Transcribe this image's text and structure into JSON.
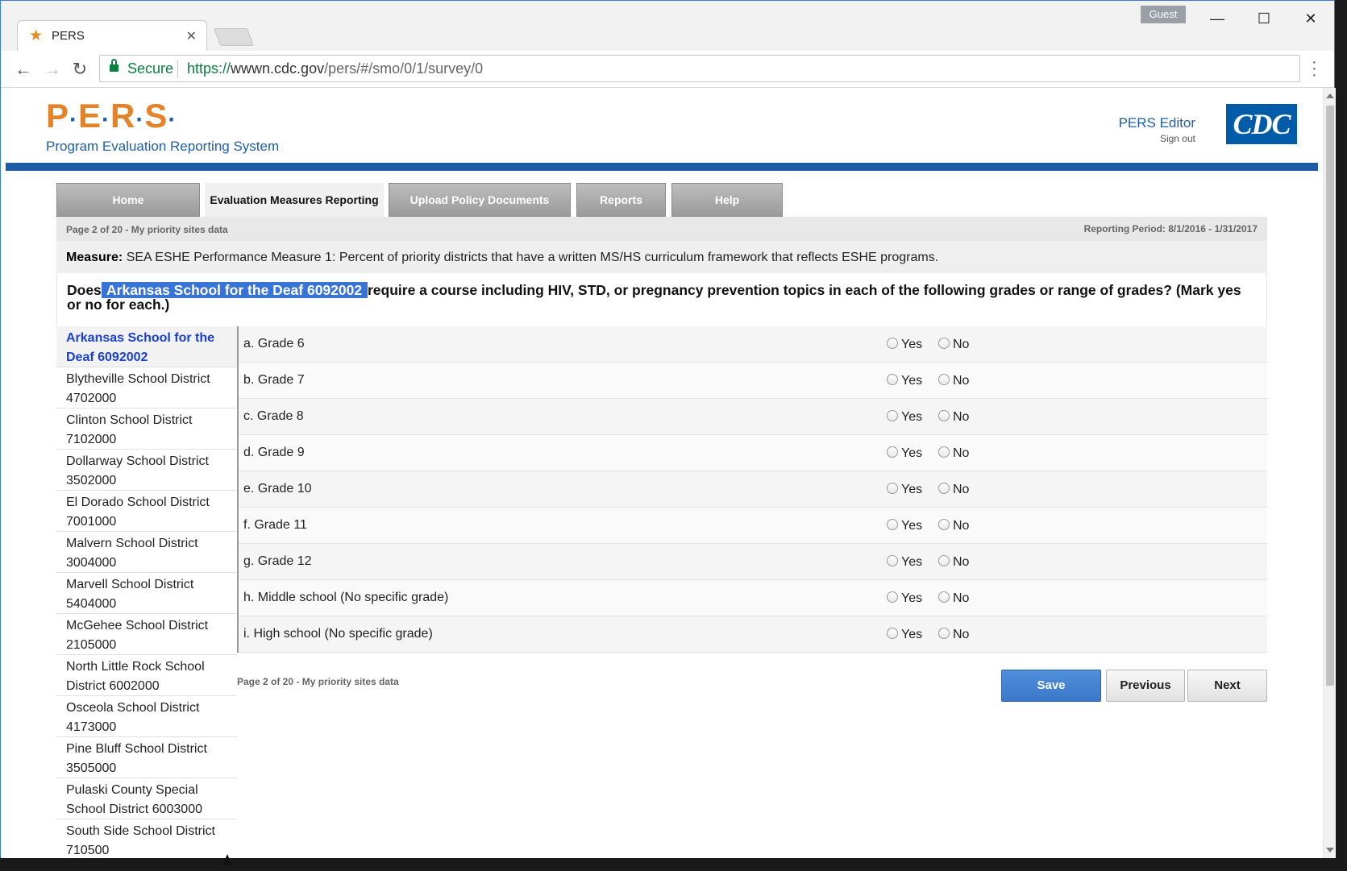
{
  "browser": {
    "tab_title": "PERS",
    "guest_label": "Guest",
    "secure_label": "Secure",
    "url_proto": "https://",
    "url_host": "wwwn.cdc.gov",
    "url_path": "/pers/#/smo/0/1/survey/0"
  },
  "header": {
    "logo_letters": [
      "P",
      "E",
      "R",
      "S"
    ],
    "subtitle": "Program Evaluation Reporting System",
    "user_name": "PERS Editor",
    "sign_out": "Sign out",
    "agency_logo": "CDC"
  },
  "nav": {
    "tabs": [
      {
        "label": "Home",
        "active": false
      },
      {
        "label": "Evaluation Measures Reporting",
        "active": true
      },
      {
        "label": "Upload Policy Documents",
        "active": false
      },
      {
        "label": "Reports",
        "active": false
      },
      {
        "label": "Help",
        "active": false
      }
    ]
  },
  "page": {
    "page_indicator": "Page 2 of 20 - My priority sites data",
    "reporting_period": "Reporting Period: 8/1/2016 - 1/31/2017",
    "measure_label": "Measure:",
    "measure_text": " SEA ESHE Performance Measure 1: Percent of priority districts that have a written MS/HS curriculum framework that reflects ESHE programs.",
    "question_prefix": "Does",
    "question_highlight": " Arkansas School for the Deaf 6092002 ",
    "question_suffix": "require a course including HIV, STD, or pregnancy prevention topics in each of the following grades or range of grades? (Mark yes or no for each.)"
  },
  "sites": [
    {
      "name": "Arkansas School for the Deaf 6092002",
      "active": true
    },
    {
      "name": "Blytheville School District 4702000",
      "active": false
    },
    {
      "name": "Clinton School District 7102000",
      "active": false
    },
    {
      "name": "Dollarway School District 3502000",
      "active": false
    },
    {
      "name": "El Dorado School District 7001000",
      "active": false
    },
    {
      "name": "Malvern School District 3004000",
      "active": false
    },
    {
      "name": "Marvell School District 5404000",
      "active": false
    },
    {
      "name": "McGehee School District 2105000",
      "active": false
    },
    {
      "name": "North Little Rock School District 6002000",
      "active": false
    },
    {
      "name": "Osceola School District 4173000",
      "active": false
    },
    {
      "name": "Pine Bluff School District 3505000",
      "active": false
    },
    {
      "name": "Pulaski County Special School District 6003000",
      "active": false
    },
    {
      "name": "South Side School District 710500",
      "active": false
    }
  ],
  "grades": [
    {
      "label": "a. Grade 6"
    },
    {
      "label": "b. Grade 7"
    },
    {
      "label": "c. Grade 8"
    },
    {
      "label": "d. Grade 9"
    },
    {
      "label": "e. Grade 10"
    },
    {
      "label": "f. Grade 11"
    },
    {
      "label": "g. Grade 12"
    },
    {
      "label": "h. Middle school (No specific grade)"
    },
    {
      "label": "i. High school (No specific grade)"
    }
  ],
  "options": {
    "yes": "Yes",
    "no": "No"
  },
  "buttons": {
    "save": "Save",
    "previous": "Previous",
    "next": "Next"
  }
}
